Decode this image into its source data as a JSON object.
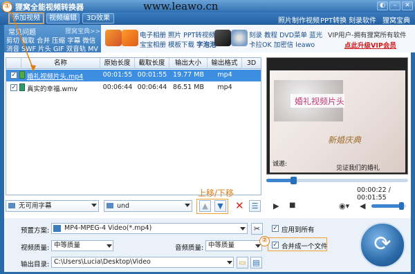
{
  "app": {
    "title": "狸窝全能视频转换器",
    "watermark": "www.leawo.cn"
  },
  "toolbar": {
    "tabs": [
      "添加视频",
      "视频编辑",
      "3D效果"
    ],
    "links": [
      "照片制作视频",
      "PPT转换",
      "刻录软件",
      "狸窝宝典"
    ]
  },
  "menu": {
    "header": "常见问题",
    "header_right": "狸窝宝典>>",
    "row1": [
      "剪切",
      "截取",
      "合并",
      "压缩",
      "字幕",
      "微信"
    ],
    "row2": [
      "消音",
      "SWF",
      "片头",
      "GIF",
      "双音轨",
      "MV"
    ]
  },
  "banner": {
    "group1_row1": [
      "电子相册",
      "照片",
      "PPT转视频"
    ],
    "group1_row2": [
      "宝宝相册",
      "模板下载",
      "字泡泡"
    ],
    "group2_row1": [
      "刻录",
      "教程",
      "DVD菜单",
      "蓝光"
    ],
    "group2_row2": [
      "卡拉OK",
      "加密信",
      "leawo"
    ],
    "vip_line": "VIP用户-拥有狸窝所有软件",
    "vip_link": "点此升级VIP会员"
  },
  "table": {
    "headers": [
      "名称",
      "原始长度",
      "截取长度",
      "输出大小",
      "输出格式",
      "3D"
    ],
    "rows": [
      {
        "name": "婚礼视频片头.mp4",
        "orig": "00:01:55",
        "cut": "00:01:55",
        "size": "19.77 MB",
        "format": "mp4",
        "checked": true,
        "selected": true
      },
      {
        "name": "真实的幸福.wmv",
        "orig": "00:06:44",
        "cut": "00:06:44",
        "size": "86.51 MB",
        "format": "mp4",
        "checked": true,
        "selected": false
      }
    ]
  },
  "preview": {
    "title_text": "婚礼视频片头",
    "sub_text": "新婚庆典",
    "caption_left": "诚邀:",
    "caption_right": "见证我们的婚礼"
  },
  "player": {
    "progress": 0.19,
    "time": "00:00:22 / 00:01:55",
    "volume": 0.85
  },
  "subtitle_combo": "无可用字幕",
  "audio_combo": "und",
  "move_annotation": "上移/下移",
  "settings": {
    "preset_label": "预置方案:",
    "preset_value": "MP4-MPEG-4 Video(*.mp4)",
    "apply_all": "应用到所有",
    "video_quality_label": "视频质量:",
    "video_quality": "中等质量",
    "audio_quality_label": "音频质量:",
    "audio_quality": "中等质量",
    "merge_label": "合并成一个文件",
    "output_label": "输出目录:",
    "output_path": "C:\\Users\\Lucia\\Desktop\\Video"
  },
  "annotations": [
    "①",
    "②"
  ],
  "colors": {
    "accent": "#2b6aa8",
    "selection": "#3d8ee0",
    "highlight": "#f0a030"
  }
}
